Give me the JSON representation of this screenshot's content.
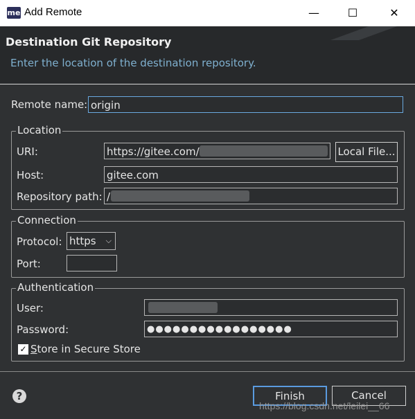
{
  "window": {
    "title": "Add Remote",
    "app_icon": "me"
  },
  "header": {
    "title": "Destination Git Repository",
    "description": "Enter the location of the destination repository."
  },
  "remote_name": {
    "label": "Remote name:",
    "value": "origin"
  },
  "location": {
    "legend": "Location",
    "uri_label": "URI:",
    "uri_value": "https://gitee.com/",
    "local_file_button": "Local File...",
    "host_label": "Host:",
    "host_value": "gitee.com",
    "repo_path_label": "Repository path:",
    "repo_path_value": "/"
  },
  "connection": {
    "legend": "Connection",
    "protocol_label": "Protocol:",
    "protocol_value": "https",
    "port_label": "Port:",
    "port_value": ""
  },
  "authentication": {
    "legend": "Authentication",
    "user_label": "User:",
    "user_value": "",
    "password_label": "Password:",
    "password_value": "●●●●●●●●●●●●●●●●●",
    "store_label": "Store in Secure Store",
    "store_mnemonic": "S",
    "store_rest": "tore in Secure Store",
    "store_checked": true
  },
  "footer": {
    "finish_button": "Finish",
    "cancel_button": "Cancel",
    "watermark": "https://blog.csdn.net/leilei__66"
  }
}
